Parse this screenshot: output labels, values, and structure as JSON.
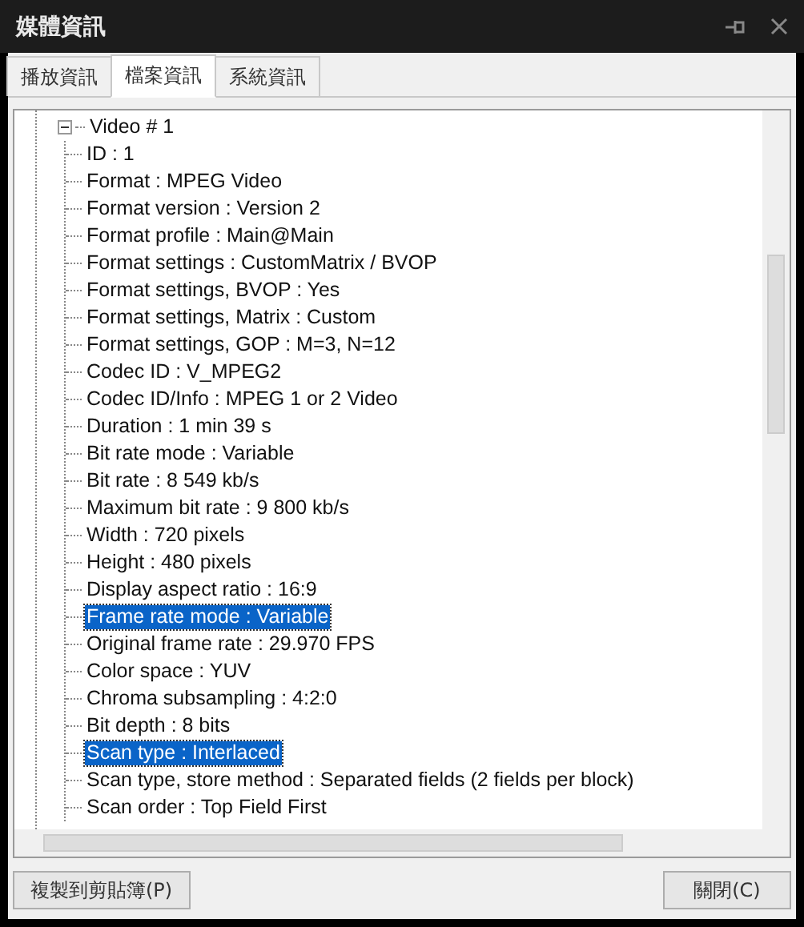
{
  "window": {
    "title": "媒體資訊"
  },
  "tabs": [
    {
      "label": "播放資訊",
      "selected": false
    },
    {
      "label": "檔案資訊",
      "selected": true
    },
    {
      "label": "系統資訊",
      "selected": false
    }
  ],
  "tree": [
    {
      "label": "Video # 1",
      "expanded": true,
      "selected": false,
      "children": [
        {
          "label": "ID : 1",
          "selected": false
        },
        {
          "label": "Format : MPEG Video",
          "selected": false
        },
        {
          "label": "Format version : Version 2",
          "selected": false
        },
        {
          "label": "Format profile : Main@Main",
          "selected": false
        },
        {
          "label": "Format settings : CustomMatrix / BVOP",
          "selected": false
        },
        {
          "label": "Format settings, BVOP : Yes",
          "selected": false
        },
        {
          "label": "Format settings, Matrix : Custom",
          "selected": false
        },
        {
          "label": "Format settings, GOP : M=3, N=12",
          "selected": false
        },
        {
          "label": "Codec ID : V_MPEG2",
          "selected": false
        },
        {
          "label": "Codec ID/Info : MPEG 1 or 2 Video",
          "selected": false
        },
        {
          "label": "Duration : 1 min 39 s",
          "selected": false
        },
        {
          "label": "Bit rate mode : Variable",
          "selected": false
        },
        {
          "label": "Bit rate : 8 549 kb/s",
          "selected": false
        },
        {
          "label": "Maximum bit rate : 9 800 kb/s",
          "selected": false
        },
        {
          "label": "Width : 720 pixels",
          "selected": false
        },
        {
          "label": "Height : 480 pixels",
          "selected": false
        },
        {
          "label": "Display aspect ratio : 16:9",
          "selected": false
        },
        {
          "label": "Frame rate mode : Variable",
          "selected": true
        },
        {
          "label": "Original frame rate : 29.970 FPS",
          "selected": false
        },
        {
          "label": "Color space : YUV",
          "selected": false
        },
        {
          "label": "Chroma subsampling : 4:2:0",
          "selected": false
        },
        {
          "label": "Bit depth : 8 bits",
          "selected": false
        },
        {
          "label": "Scan type : Interlaced",
          "selected": true
        },
        {
          "label": "Scan type, store method : Separated fields (2 fields per block)",
          "selected": false
        },
        {
          "label": "Scan order : Top Field First",
          "selected": false
        }
      ]
    }
  ],
  "buttons": [
    {
      "label": "複製到剪貼簿(P)"
    },
    {
      "label": "關閉(C)"
    }
  ]
}
